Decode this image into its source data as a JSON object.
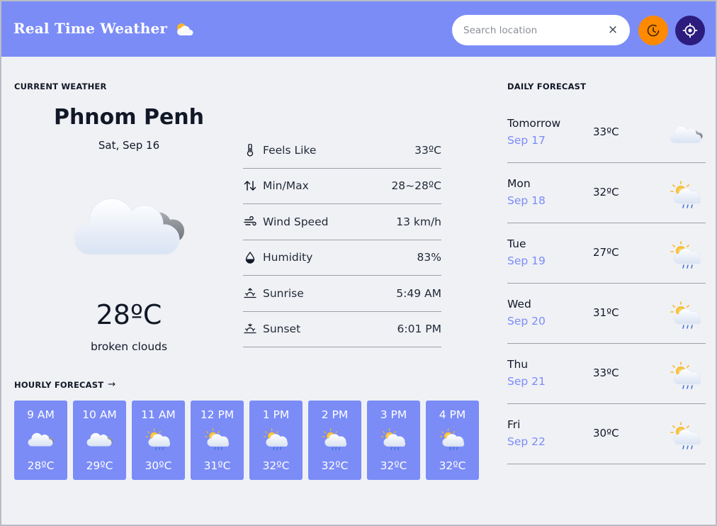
{
  "header": {
    "title": "Real Time Weather",
    "logo_icon": "sun-cloud-icon",
    "search_placeholder": "Search location",
    "clear_icon": "close-icon",
    "clear_label": "×",
    "history_icon": "history-icon",
    "locate_icon": "locate-icon",
    "colors": {
      "bar": "#7b8cf7",
      "history": "#ff8a00",
      "locate": "#2c1c7e"
    }
  },
  "current": {
    "section_label": "CURRENT WEATHER",
    "city": "Phnom Penh",
    "date": "Sat, Sep 16",
    "icon": "cloudy-icon",
    "temperature": "28ºC",
    "description": "broken clouds",
    "details": [
      {
        "icon": "thermometer-icon",
        "label": "Feels Like",
        "value": "33ºC"
      },
      {
        "icon": "min-max-icon",
        "label": "Min/Max",
        "value": "28~28ºC"
      },
      {
        "icon": "wind-icon",
        "label": "Wind Speed",
        "value": "13 km/h"
      },
      {
        "icon": "humidity-icon",
        "label": "Humidity",
        "value": "83%"
      },
      {
        "icon": "sunrise-icon",
        "label": "Sunrise",
        "value": "5:49 AM"
      },
      {
        "icon": "sunset-icon",
        "label": "Sunset",
        "value": "6:01 PM"
      }
    ]
  },
  "hourly": {
    "section_label": "HOURLY FORECAST",
    "arrow": "→",
    "items": [
      {
        "time": "9 AM",
        "icon": "cloudy-icon",
        "temp": "28ºC"
      },
      {
        "time": "10 AM",
        "icon": "cloudy-icon",
        "temp": "29ºC"
      },
      {
        "time": "11 AM",
        "icon": "sun-rain-icon",
        "temp": "30ºC"
      },
      {
        "time": "12 PM",
        "icon": "sun-rain-icon",
        "temp": "31ºC"
      },
      {
        "time": "1 PM",
        "icon": "sun-rain-icon",
        "temp": "32ºC"
      },
      {
        "time": "2 PM",
        "icon": "sun-rain-icon",
        "temp": "32ºC"
      },
      {
        "time": "3 PM",
        "icon": "sun-rain-icon",
        "temp": "32ºC"
      },
      {
        "time": "4 PM",
        "icon": "sun-rain-icon",
        "temp": "32ºC"
      }
    ]
  },
  "daily": {
    "section_label": "DAILY FORECAST",
    "items": [
      {
        "day": "Tomorrow",
        "date": "Sep 17",
        "temp": "33ºC",
        "icon": "cloudy-icon"
      },
      {
        "day": "Mon",
        "date": "Sep 18",
        "temp": "32ºC",
        "icon": "sun-rain-icon"
      },
      {
        "day": "Tue",
        "date": "Sep 19",
        "temp": "27ºC",
        "icon": "sun-rain-icon"
      },
      {
        "day": "Wed",
        "date": "Sep 20",
        "temp": "31ºC",
        "icon": "sun-rain-icon"
      },
      {
        "day": "Thu",
        "date": "Sep 21",
        "temp": "33ºC",
        "icon": "sun-rain-icon"
      },
      {
        "day": "Fri",
        "date": "Sep 22",
        "temp": "30ºC",
        "icon": "sun-rain-icon"
      }
    ]
  }
}
